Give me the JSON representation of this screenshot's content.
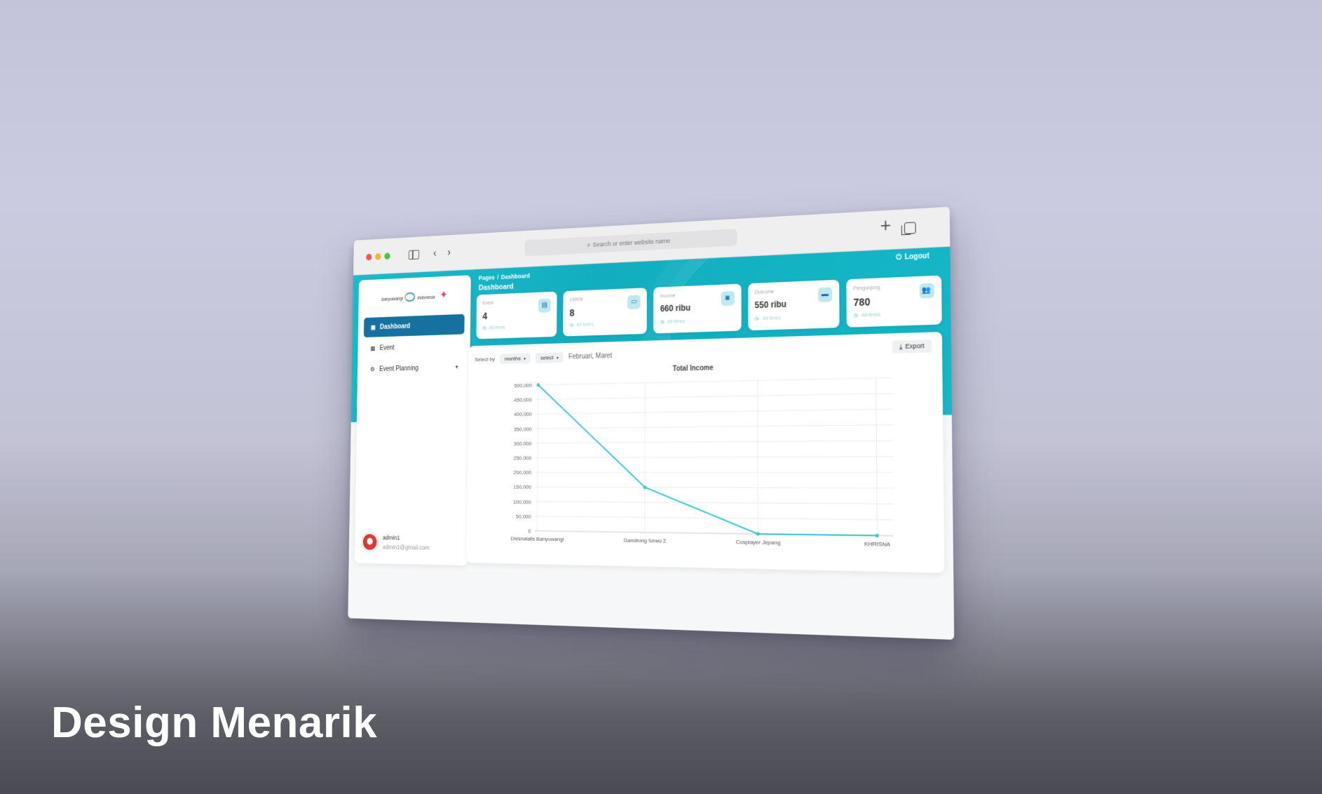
{
  "browser": {
    "url_placeholder": "Search or enter website name"
  },
  "header": {
    "breadcrumb_root": "Pages",
    "breadcrumb_sep": "/",
    "breadcrumb_current": "Dashboard",
    "title": "Dashboard",
    "logout_label": "Logout"
  },
  "sidebar": {
    "logo_left": "banyuwangi",
    "logo_right": "indonesia",
    "items": [
      {
        "label": "Dashboard",
        "icon": "dashboard-icon",
        "active": true
      },
      {
        "label": "Event",
        "icon": "calendar-icon",
        "active": false
      },
      {
        "label": "Event Planning",
        "icon": "planning-icon",
        "active": false
      }
    ],
    "user": {
      "name": "admin1",
      "email": "admin1@gmail.com"
    }
  },
  "cards": [
    {
      "label": "Event",
      "value": "4",
      "foot": "All times",
      "icon": "calendar-icon"
    },
    {
      "label": "UMKM",
      "value": "8",
      "foot": "All times",
      "icon": "store-icon"
    },
    {
      "label": "Income",
      "value": "660 ribu",
      "foot": "All times",
      "icon": "money-icon"
    },
    {
      "label": "Outcome",
      "value": "550 ribu",
      "foot": "All times",
      "icon": "wallet-icon"
    },
    {
      "label": "Pengunjung",
      "value": "780",
      "foot": "All times",
      "icon": "users-icon"
    }
  ],
  "filters": {
    "select_by_label": "Select by",
    "period": "months",
    "select": "select",
    "value": "Februari, Maret",
    "export_label": "Export"
  },
  "chart_data": {
    "type": "line",
    "title": "Total Income",
    "categories": [
      "Diesnatalis Banyuwangi",
      "Gandrung Sewu 2",
      "Cosplayer Jepang",
      "KHRISNA"
    ],
    "values": [
      500000,
      150000,
      0,
      0
    ],
    "ylim": [
      0,
      500000
    ],
    "yticks": [
      "500,000",
      "450,000",
      "400,000",
      "350,000",
      "300,000",
      "250,000",
      "200,000",
      "150,000",
      "100,000",
      "50,000",
      "0"
    ],
    "grid": true,
    "color": "#3cc6cf"
  },
  "caption": "Design Menarik"
}
